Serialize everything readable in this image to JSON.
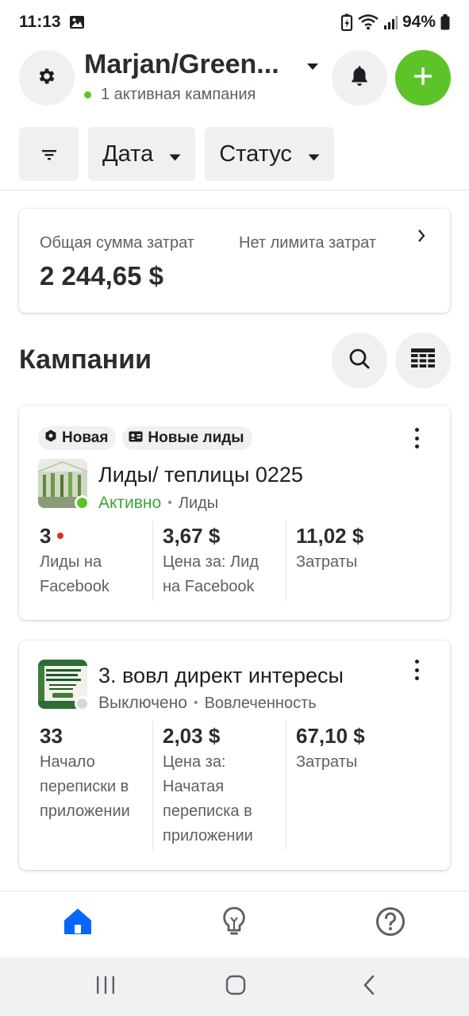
{
  "status_bar": {
    "time": "11:13",
    "battery": "94%",
    "icons": [
      "gallery-icon",
      "battery-saver-icon",
      "wifi-icon",
      "signal-icon",
      "battery-icon"
    ]
  },
  "header": {
    "account_name": "Marjan/Green...",
    "active_campaigns": "1 активная кампания",
    "icons": [
      "gear-icon",
      "bell-icon",
      "plus-icon",
      "caret-down-icon"
    ]
  },
  "filters": {
    "date_label": "Дата",
    "status_label": "Статус",
    "icons": [
      "filter-icon"
    ]
  },
  "spend": {
    "label": "Общая сумма затрат",
    "limit_label": "Нет лимита затрат",
    "value": "2 244,65 $"
  },
  "campaigns_section": {
    "title": "Кампании",
    "icons": [
      "search-icon",
      "table-icon"
    ]
  },
  "campaigns": [
    {
      "tags": [
        "Новая",
        "Новые лиды"
      ],
      "name": "Лиды/ теплицы 0225",
      "status": "Активно",
      "objective": "Лиды",
      "status_color": "#5cc428",
      "metrics": [
        {
          "value": "3",
          "label_1": "Лиды на",
          "label_2": "Facebook"
        },
        {
          "value": "3,67 $",
          "label_1": "Цена за: Лид",
          "label_2": "на Facebook"
        },
        {
          "value": "11,02 $",
          "label_1": "Затраты"
        }
      ]
    },
    {
      "name": "3. вовл директ интересы",
      "status": "Выключено",
      "objective": "Вовлеченность",
      "status_color": "#d6d8db",
      "metrics": [
        {
          "value": "33",
          "label_1": "Начало",
          "label_2": "переписки в",
          "label_3": "приложении"
        },
        {
          "value": "2,03 $",
          "label_1": "Цена за:",
          "label_2": "Начатая",
          "label_3": "переписка в",
          "label_4": "приложении"
        },
        {
          "value": "67,10 $",
          "label_1": "Затраты"
        }
      ]
    }
  ],
  "bottom_nav": {
    "items": [
      "home-icon",
      "lightbulb-icon",
      "help-icon"
    ],
    "active_color": "#0866ff"
  },
  "system_nav": [
    "recents-icon",
    "home-circle-icon",
    "back-icon"
  ],
  "colors": {
    "accent_green": "#5cc428",
    "active_text": "#3aa536",
    "alert_red": "#e02e1f",
    "brand_blue": "#0866ff"
  }
}
